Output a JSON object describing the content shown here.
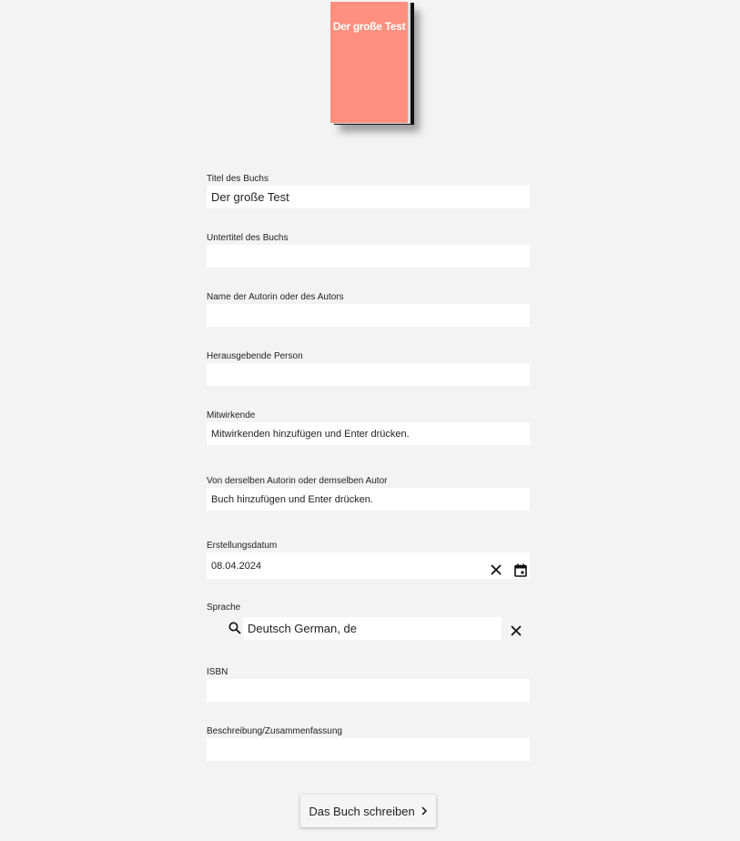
{
  "cover": {
    "title": "Der große Test",
    "color": "#ff8f7e"
  },
  "fields": {
    "title": {
      "label": "Titel des Buchs",
      "value": "Der große Test"
    },
    "subtitle": {
      "label": "Untertitel des Buchs",
      "value": ""
    },
    "author": {
      "label": "Name der Autorin oder des Autors",
      "value": ""
    },
    "editor": {
      "label": "Herausgebende Person",
      "value": ""
    },
    "contributors": {
      "label": "Mitwirkende",
      "placeholder": "Mitwirkenden hinzufügen und Enter drücken."
    },
    "same_author": {
      "label": "Von derselben Autorin oder demselben Autor",
      "placeholder": "Buch hinzufügen und Enter drücken."
    },
    "date": {
      "label": "Erstellungsdatum",
      "value": "08.04.2024"
    },
    "language": {
      "label": "Sprache",
      "value": "Deutsch German, de"
    },
    "isbn": {
      "label": "ISBN",
      "value": ""
    },
    "description": {
      "label": "Beschreibung/Zusammenfassung",
      "value": ""
    }
  },
  "icons": {
    "clear_date": "close-icon",
    "calendar": "calendar-icon",
    "search": "search-icon",
    "clear_language": "close-icon",
    "submit_arrow": "chevron-right-icon"
  },
  "submit": {
    "label": "Das Buch schreiben"
  }
}
